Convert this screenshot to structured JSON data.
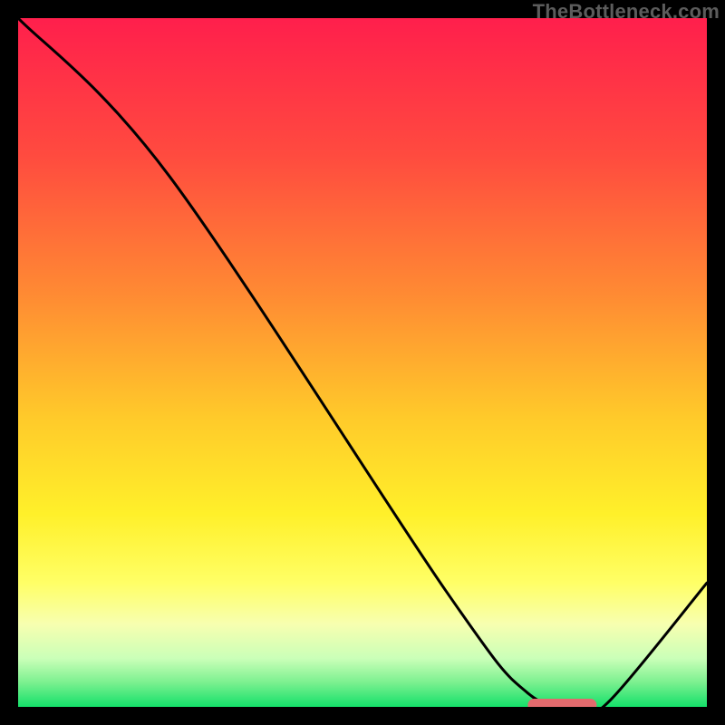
{
  "attribution": "TheBottleneck.com",
  "colors": {
    "frame": "#000000",
    "curve_stroke": "#000000",
    "marker": "#e26a6d",
    "gradient_stops": [
      {
        "offset": 0.0,
        "color": "#ff1f4c"
      },
      {
        "offset": 0.2,
        "color": "#ff4b3f"
      },
      {
        "offset": 0.4,
        "color": "#ff8a33"
      },
      {
        "offset": 0.58,
        "color": "#ffca2a"
      },
      {
        "offset": 0.72,
        "color": "#fff02a"
      },
      {
        "offset": 0.82,
        "color": "#ffff66"
      },
      {
        "offset": 0.88,
        "color": "#f7ffb0"
      },
      {
        "offset": 0.93,
        "color": "#caffb8"
      },
      {
        "offset": 0.965,
        "color": "#7af08f"
      },
      {
        "offset": 1.0,
        "color": "#14e06a"
      }
    ]
  },
  "chart_data": {
    "type": "line",
    "title": "",
    "xlabel": "",
    "ylabel": "",
    "xlim": [
      0,
      100
    ],
    "ylim": [
      0,
      100
    ],
    "grid": false,
    "legend": false,
    "series": [
      {
        "name": "bottleneck-curve",
        "x": [
          0,
          22,
          62,
          74,
          82,
          86,
          100
        ],
        "y": [
          100,
          77,
          17,
          2,
          0,
          1,
          18
        ]
      }
    ],
    "marker": {
      "x_start": 74,
      "x_end": 84,
      "y": 0
    }
  }
}
